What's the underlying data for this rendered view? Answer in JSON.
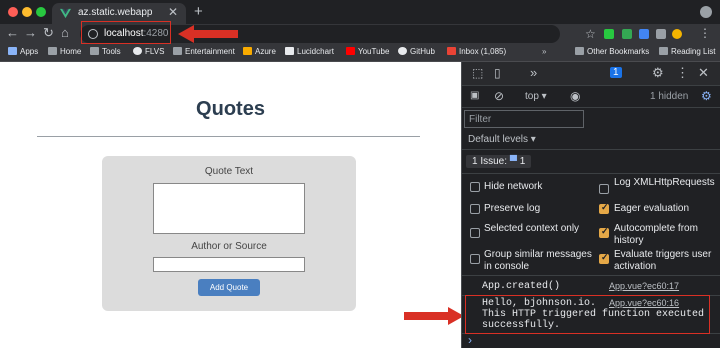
{
  "browser": {
    "tab_title": "az.static.webapp",
    "url_host": "localhost",
    "url_port": ":4280",
    "new_tab_label": "+",
    "tab_close_label": "✕",
    "bookmarks": [
      {
        "label": "Apps",
        "color": "#8ab4f8"
      },
      {
        "label": "Home",
        "color": "#9aa0a6"
      },
      {
        "label": "Tools",
        "color": "#9aa0a6"
      },
      {
        "label": "FLVS",
        "color": "#e8eaed"
      },
      {
        "label": "Entertainment",
        "color": "#9aa0a6"
      },
      {
        "label": "Azure",
        "color": "#f9ab00"
      },
      {
        "label": "Lucidchart",
        "color": "#e8eaed"
      },
      {
        "label": "YouTube",
        "color": "#ff0000"
      },
      {
        "label": "GitHub",
        "color": "#e8eaed"
      },
      {
        "label": "Inbox (1,085)",
        "color": "#ea4335"
      }
    ],
    "other_bookmarks": "Other Bookmarks",
    "reading_list": "Reading List"
  },
  "app": {
    "title": "Quotes",
    "quote_label": "Quote Text",
    "author_label": "Author or Source",
    "add_button": "Add Quote"
  },
  "devtools": {
    "messages_count": "1",
    "context": "top",
    "hidden_count": "1 hidden",
    "filter_placeholder": "Filter",
    "levels": "Default levels",
    "issues_label": "1 Issue:",
    "issues_count": "1",
    "settings_left": [
      {
        "label": "Hide network",
        "checked": false
      },
      {
        "label": "Preserve log",
        "checked": false
      },
      {
        "label": "Selected context only",
        "checked": false
      },
      {
        "label": "Group similar messages in console",
        "checked": false
      }
    ],
    "settings_right": [
      {
        "label": "Log XMLHttpRequests",
        "checked": false
      },
      {
        "label": "Eager evaluation",
        "checked": true
      },
      {
        "label": "Autocomplete from history",
        "checked": true
      },
      {
        "label": "Evaluate triggers user activation",
        "checked": true
      }
    ],
    "logs": [
      {
        "text": "App.created()",
        "source": "App.vue?ec60:17"
      },
      {
        "text": "Hello, bjohnson.io. This HTTP triggered function executed successfully.",
        "line1": "Hello, bjohnson.io.",
        "line2": "This HTTP triggered function executed",
        "line3": "successfully.",
        "source": "App.vue?ec60:16"
      }
    ],
    "prompt": "›"
  },
  "colors": {
    "annotation_red": "#d93025",
    "devtools_bg": "#202124",
    "button_blue": "#4a7fc0"
  }
}
